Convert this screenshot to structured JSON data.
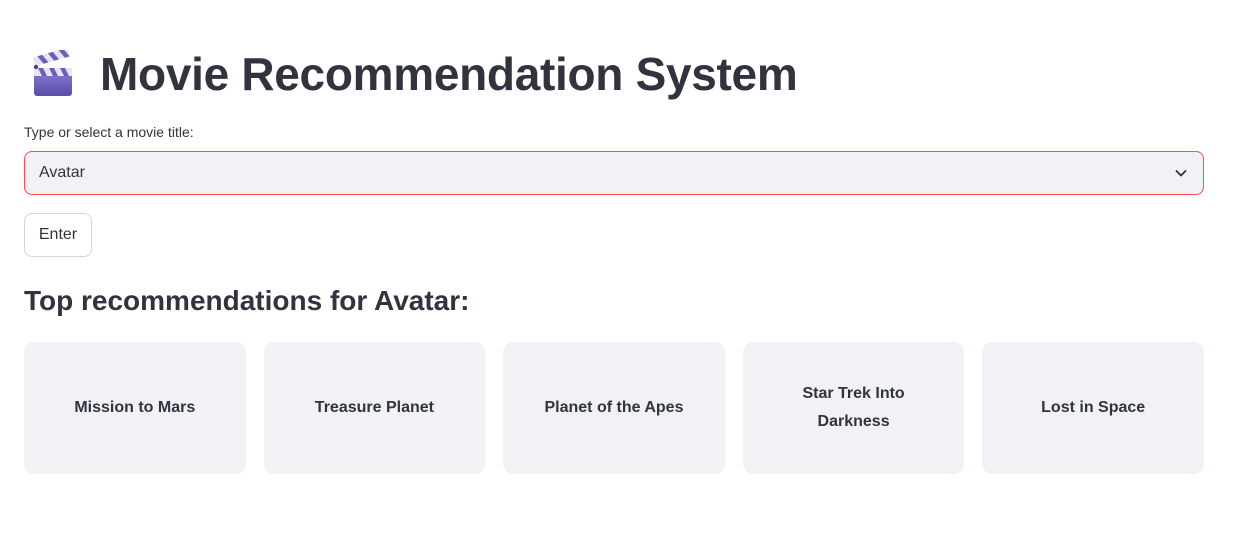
{
  "header": {
    "icon": "clapperboard-icon",
    "title": "Movie Recommendation System"
  },
  "movie_select": {
    "label": "Type or select a movie title:",
    "value": "Avatar",
    "icon": "chevron-down-icon"
  },
  "enter_button": {
    "label": "Enter"
  },
  "recommendations": {
    "heading": "Top recommendations for Avatar:",
    "items": [
      {
        "title": "Mission to Mars"
      },
      {
        "title": "Treasure Planet"
      },
      {
        "title": "Planet of the Apes"
      },
      {
        "title": "Star Trek Into Darkness"
      },
      {
        "title": "Lost in Space"
      }
    ]
  },
  "colors": {
    "text": "#31333f",
    "accent_border": "#ff4b4b",
    "input_background": "#f0f2f6",
    "card_background": "#f0f2f6"
  }
}
